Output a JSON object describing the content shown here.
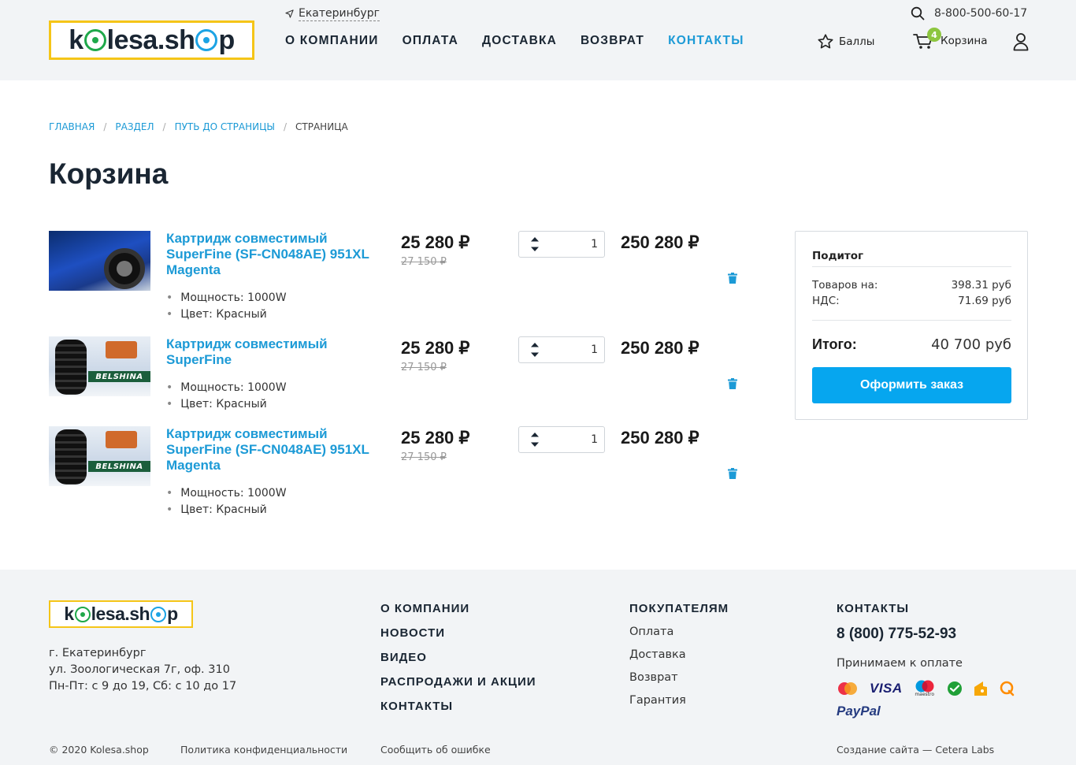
{
  "header": {
    "logo": {
      "pre": "k",
      "mid": "lesa.sh",
      "post": "p"
    },
    "city": "Екатеринбург",
    "nav": [
      "О КОМПАНИИ",
      "ОПЛАТА",
      "ДОСТАВКА",
      "ВОЗВРАТ",
      "КОНТАКТЫ"
    ],
    "nav_active": "КОНТАКТЫ",
    "phone": "8-800-500-60-17",
    "points_label": "Баллы",
    "cart_label": "Корзина",
    "cart_count": "4"
  },
  "breadcrumbs": [
    "ГЛАВНАЯ",
    "РАЗДЕЛ",
    "ПУТЬ ДО СТРАНИЦЫ",
    "СТРАНИЦА"
  ],
  "page_title": "Корзина",
  "cart_items": [
    {
      "image": "car-tyre-photo",
      "name": "Картридж совместимый SuperFine (SF-CN048AE) 951XL Magenta",
      "price": "25 280 ₽",
      "old_price": "27 150 ₽",
      "qty": "1",
      "total": "250 280 ₽",
      "props": [
        "Мощность: 1000W",
        "Цвет: Красный"
      ]
    },
    {
      "image": "belshina-tyre-photo",
      "name": "Картридж совместимый SuperFine",
      "price": "25 280 ₽",
      "old_price": "27 150 ₽",
      "qty": "1",
      "total": "250 280 ₽",
      "props": [
        "Мощность: 1000W",
        "Цвет: Красный"
      ]
    },
    {
      "image": "belshina-tyre-photo",
      "name": "Картридж совместимый SuperFine (SF-CN048AE) 951XL Magenta",
      "price": "25 280 ₽",
      "old_price": "27 150 ₽",
      "qty": "1",
      "total": "250 280 ₽",
      "props": [
        "Мощность: 1000W",
        "Цвет: Красный"
      ]
    }
  ],
  "belshina_text": "BELSHINA",
  "summary": {
    "title": "Подитог",
    "goods_label": "Товаров на:",
    "goods_value": "398.31 руб",
    "vat_label": "НДС:",
    "vat_value": "71.69 руб",
    "total_label": "Итого:",
    "total_value": "40 700 руб",
    "order_button": "Оформить заказ"
  },
  "footer": {
    "address": [
      "г. Екатеринбург",
      "ул. Зоологическая 7г, оф. 310",
      "Пн-Пт: с 9 до 19, Сб: с 10 до 17"
    ],
    "col1": [
      "О КОМПАНИИ",
      "НОВОСТИ",
      "ВИДЕО",
      "РАСПРОДАЖИ И АКЦИИ",
      "КОНТАКТЫ"
    ],
    "col2_title": "ПОКУПАТЕЛЯМ",
    "col2": [
      "Оплата",
      "Доставка",
      "Возврат",
      "Гарантия"
    ],
    "col3_title": "КОНТАКТЫ",
    "phone": "8 (800) 775-52-93",
    "accept_label": "Принимаем к оплате",
    "payments": [
      "mastercard-icon",
      "visa-icon",
      "maestro-icon",
      "sberbank-icon",
      "yandex-money-icon",
      "qiwi-icon",
      "paypal-icon"
    ],
    "visa_text": "VISA",
    "maestro_text": "maestro",
    "paypal_text": "PayPal",
    "copyright": "© 2020 Kolesa.shop",
    "privacy": "Политика конфиденциальности",
    "report": "Сообщить об ошибке",
    "credits": "Создание сайта — Cetera Labs"
  },
  "colors": {
    "accent": "#1c9ad6",
    "button": "#06a6ef",
    "logo_border": "#f5c518",
    "badge": "#8dc63f"
  }
}
